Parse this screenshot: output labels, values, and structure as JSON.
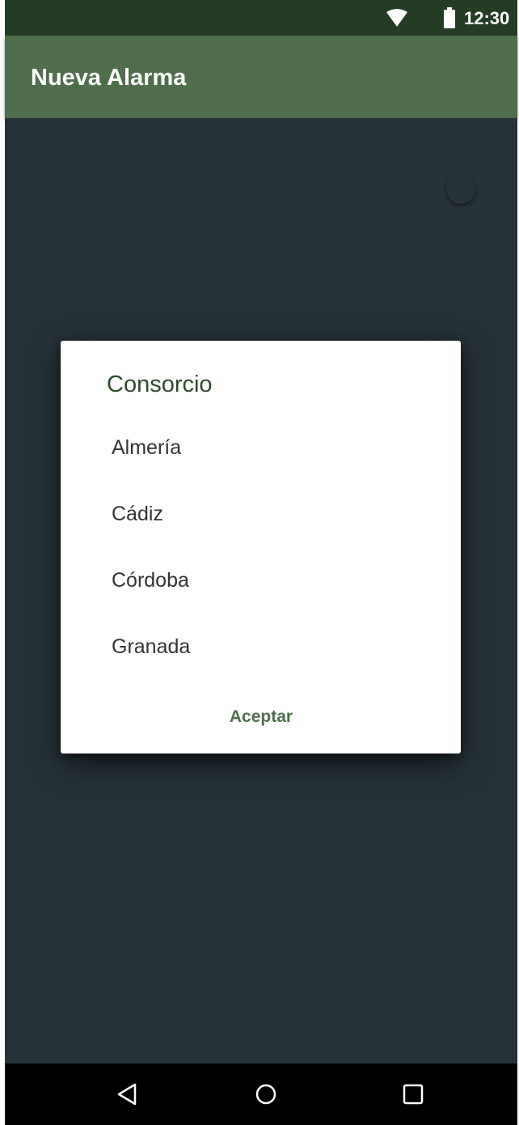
{
  "status_bar": {
    "time": "12:30",
    "icons": [
      "wifi-icon",
      "battery-icon"
    ]
  },
  "app_bar": {
    "title": "Nueva Alarma"
  },
  "dialog": {
    "title": "Consorcio",
    "options": [
      {
        "label": "Almería"
      },
      {
        "label": "Cádiz"
      },
      {
        "label": "Córdoba"
      },
      {
        "label": "Granada"
      }
    ],
    "accept_label": "Aceptar"
  },
  "nav_bar": {
    "icons": [
      "back-icon",
      "home-icon",
      "recents-icon"
    ]
  },
  "colors": {
    "status_bar": "#243c24",
    "app_bar": "#4f6e4b",
    "background": "#263238",
    "dialog": "#ffffff",
    "accent": "#4f6e4b",
    "dialog_title": "#2e4a2c"
  }
}
